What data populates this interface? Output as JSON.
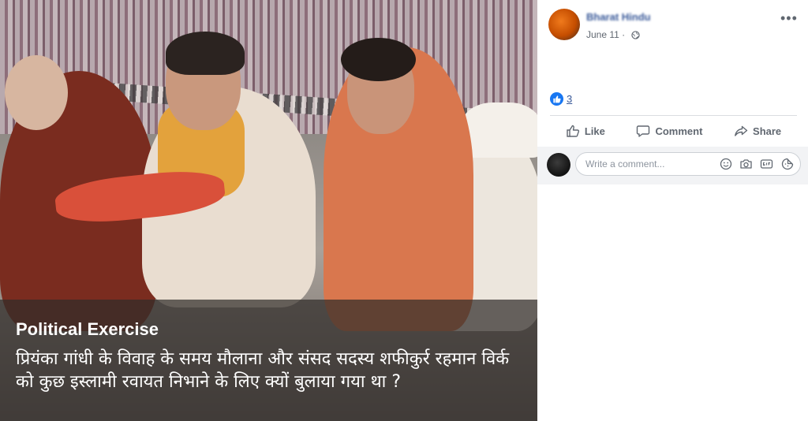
{
  "photo": {
    "caption_title": "Political Exercise",
    "caption_text": "प्रियंका गांधी के विवाह के समय मौलाना और संसद सदस्य शफीकुर्र रहमान विर्क को कुछ इस्लामी रवायत निभाने के लिए क्यों बुलाया गया था ?"
  },
  "post": {
    "author": "Bharat Hindu",
    "date": "June 11",
    "separator": "·",
    "more": "•••",
    "reaction_count": "3"
  },
  "actions": {
    "like": "Like",
    "comment": "Comment",
    "share": "Share"
  },
  "comment_box": {
    "placeholder": "Write a comment..."
  },
  "colors": {
    "link": "#385898",
    "like_blue": "#1877f2",
    "muted": "#606770"
  }
}
